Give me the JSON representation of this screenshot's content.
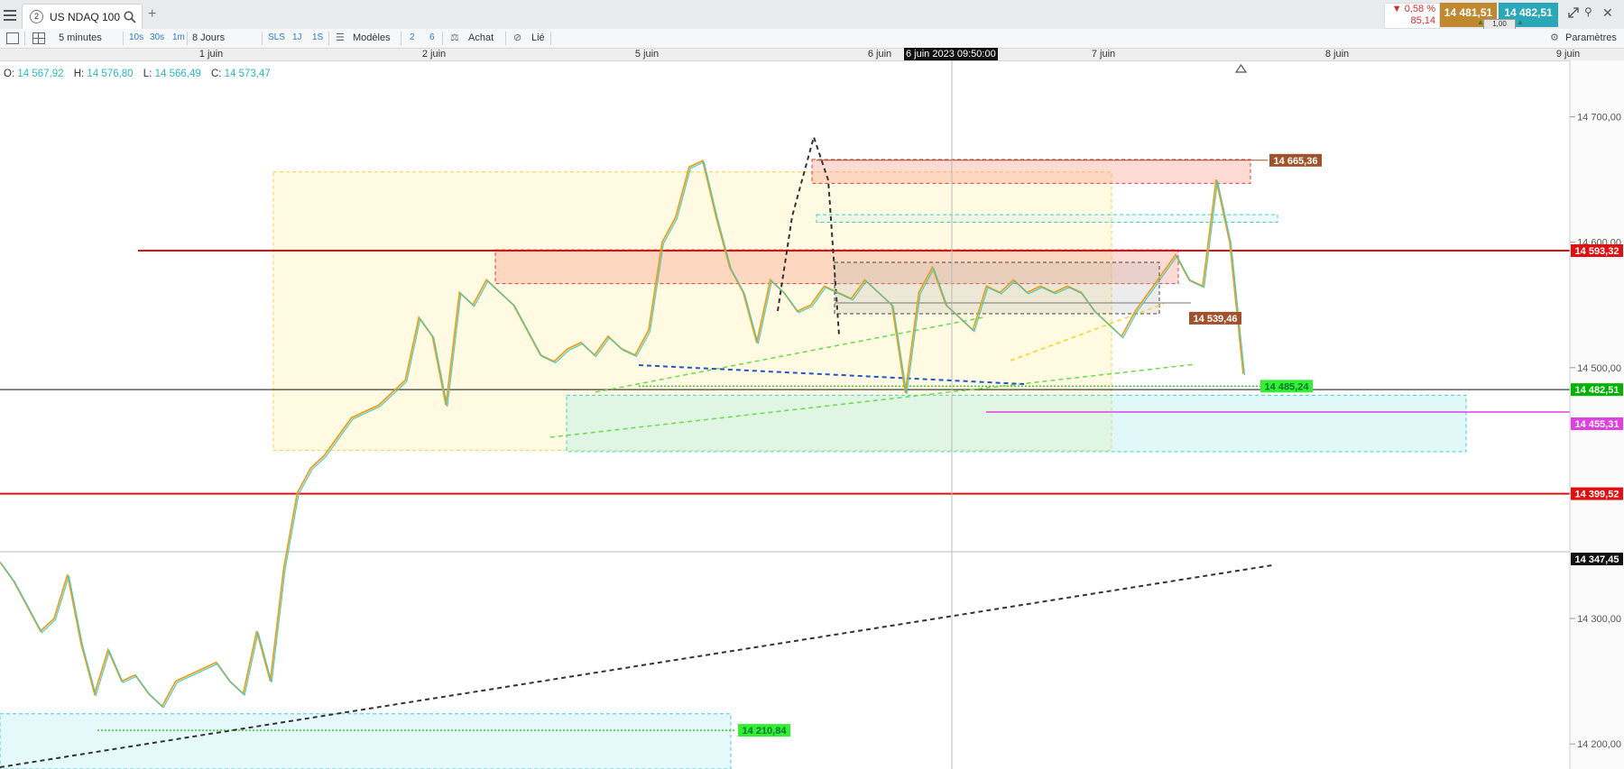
{
  "header": {
    "menu_icon": "hamburger-icon",
    "tab_number": "2",
    "instrument": "US NDAQ 100",
    "search_icon": "search-icon",
    "add_tab": "+",
    "change_pct": "0,58 %",
    "change_pts": "85,14",
    "bid": "14 481,51",
    "ask": "14 482,51",
    "size": "1,00",
    "params_label": "Paramètres",
    "colors": {
      "down": "#d32f2f",
      "bid_bg": "#c0892f",
      "ask_bg": "#2aa7b8",
      "size_bg": "#2e7d32"
    }
  },
  "toolbar": {
    "timeframe": "5 minutes",
    "tf_buttons": [
      "10s",
      "30s",
      "1m"
    ],
    "period": "8 Jours",
    "mode_buttons": [
      "SLS",
      "1J",
      "1S"
    ],
    "models_label": "Modèles",
    "num_buttons": [
      "2",
      "6"
    ],
    "buy_label": "Achat",
    "link_label": "Lié"
  },
  "date_axis": {
    "labels": [
      "1 juin",
      "2 juin",
      "5 juin",
      "6 juin",
      "7 juin",
      "8 juin",
      "9 juin"
    ],
    "cursor_label": "6 juin 2023 09:50:00"
  },
  "ohlc": {
    "o_label": "O:",
    "o": "14 567,92",
    "h_label": "H:",
    "h": "14 576,80",
    "l_label": "L:",
    "l": "14 566,49",
    "c_label": "C:",
    "c": "14 573,47"
  },
  "chart_data": {
    "type": "line",
    "title": "US NDAQ 100",
    "timeframe": "5 minutes",
    "ylim": [
      14180,
      14745
    ],
    "y_ticks": [
      14200,
      14300,
      14400,
      14500,
      14600,
      14700
    ],
    "y_tick_labels": [
      "14 200,00",
      "14 300,00",
      "14 400,00",
      "14 500,00",
      "14 600,00",
      "14 700,00"
    ],
    "x_categories": [
      "1 juin",
      "2 juin",
      "5 juin",
      "6 juin",
      "7 juin",
      "8 juin",
      "9 juin"
    ],
    "series": [
      {
        "values": [
          14345,
          14330,
          14310,
          14290,
          14300,
          14335,
          14280,
          14240,
          14275,
          14250,
          14255,
          14240,
          14230,
          14250,
          14255,
          14260,
          14265,
          14250,
          14240,
          14290,
          14250,
          14340,
          14400,
          14420,
          14430,
          14445,
          14460,
          14465,
          14470,
          14480,
          14490,
          14540,
          14525,
          14470,
          14560,
          14550,
          14570,
          14560,
          14550,
          14530,
          14510,
          14505,
          14515,
          14520,
          14510,
          14525,
          14515,
          14510,
          14530,
          14600,
          14620,
          14660,
          14665,
          14620,
          14580,
          14560,
          14520,
          14570,
          14560,
          14545,
          14550,
          14565,
          14560,
          14555,
          14570,
          14560,
          14550,
          14480,
          14560,
          14580,
          14550,
          14540,
          14530,
          14565,
          14560,
          14570,
          14560,
          14565,
          14560,
          14565,
          14560,
          14545,
          14535,
          14525,
          14545,
          14560,
          14575,
          14590,
          14570,
          14565,
          14650,
          14600,
          14495
        ]
      }
    ],
    "price_tags": [
      {
        "value": 14665.36,
        "label": "14 665,36",
        "color": "#a0522d"
      },
      {
        "value": 14593.32,
        "label": "14 593,32",
        "color": "#e01010"
      },
      {
        "value": 14539.46,
        "label": "14 539,46",
        "color": "#a0522d"
      },
      {
        "value": 14485.24,
        "label": "14 485,24",
        "color": "#33cc33"
      },
      {
        "value": 14482.51,
        "label": "14 482,51",
        "color": "#00b300"
      },
      {
        "value": 14455.31,
        "label": "14 455,31",
        "color": "#e040e0"
      },
      {
        "value": 14399.52,
        "label": "14 399,52",
        "color": "#e01010"
      },
      {
        "value": 14347.45,
        "label": "14 347,45",
        "color": "#111111"
      },
      {
        "value": 14210.84,
        "label": "14 210,84",
        "color": "#33cc33"
      }
    ],
    "horizontal_lines": [
      14593.32,
      14482.51,
      14399.52,
      14347.45,
      14455.31
    ],
    "zones": [
      {
        "kind": "yellow-range",
        "from": 14434,
        "to": 14656
      },
      {
        "kind": "red-supply",
        "from": 14567,
        "to": 14594
      },
      {
        "kind": "red-supply-top",
        "from": 14647,
        "to": 14666
      },
      {
        "kind": "grey-range",
        "from": 14543,
        "to": 14584
      },
      {
        "kind": "cyan-demand",
        "from": 14433,
        "to": 14478
      },
      {
        "kind": "cyan-demand-low",
        "from": 14180,
        "to": 14224
      },
      {
        "kind": "cyan-line",
        "from": 14616,
        "to": 14622
      }
    ],
    "grid": false,
    "legend": "none"
  }
}
